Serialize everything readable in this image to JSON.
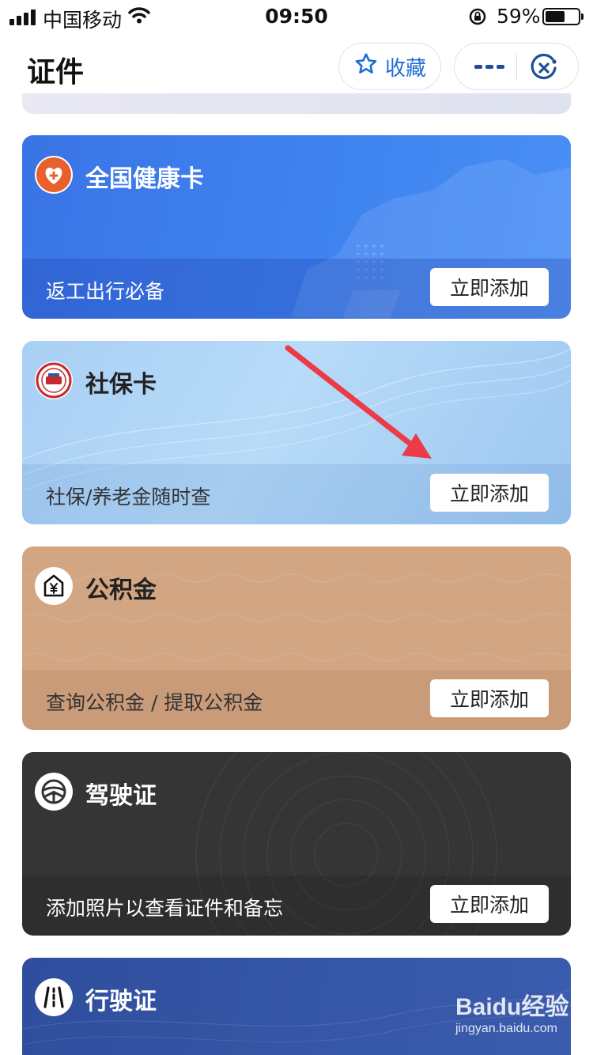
{
  "status_bar": {
    "carrier": "中国移动",
    "time": "09:50",
    "battery": "59%",
    "battery_level": 0.59
  },
  "header": {
    "title": "证件",
    "favorite_label": "收藏",
    "favorite_icon": "star-icon",
    "more_icon": "more-icon",
    "close_icon": "close-icon"
  },
  "cards": [
    {
      "title": "全国健康卡",
      "subtitle": "返工出行必备",
      "button": "立即添加",
      "icon": "health-cross-icon",
      "color": "#3f83f0"
    },
    {
      "title": "社保卡",
      "subtitle": "社保/养老金随时查",
      "button": "立即添加",
      "icon": "social-security-emblem-icon",
      "color": "#a9cff4"
    },
    {
      "title": "公积金",
      "subtitle": "查询公积金 / 提取公积金",
      "button": "立即添加",
      "icon": "house-yuan-icon",
      "color": "#d3a683"
    },
    {
      "title": "驾驶证",
      "subtitle": "添加照片以查看证件和备忘",
      "button": "立即添加",
      "icon": "steering-wheel-icon",
      "color": "#353535"
    },
    {
      "title": "行驶证",
      "icon": "road-icon",
      "color": "#2f4e9d"
    }
  ],
  "watermark": {
    "logo": "Baidu经验",
    "url": "jingyan.baidu.com"
  }
}
